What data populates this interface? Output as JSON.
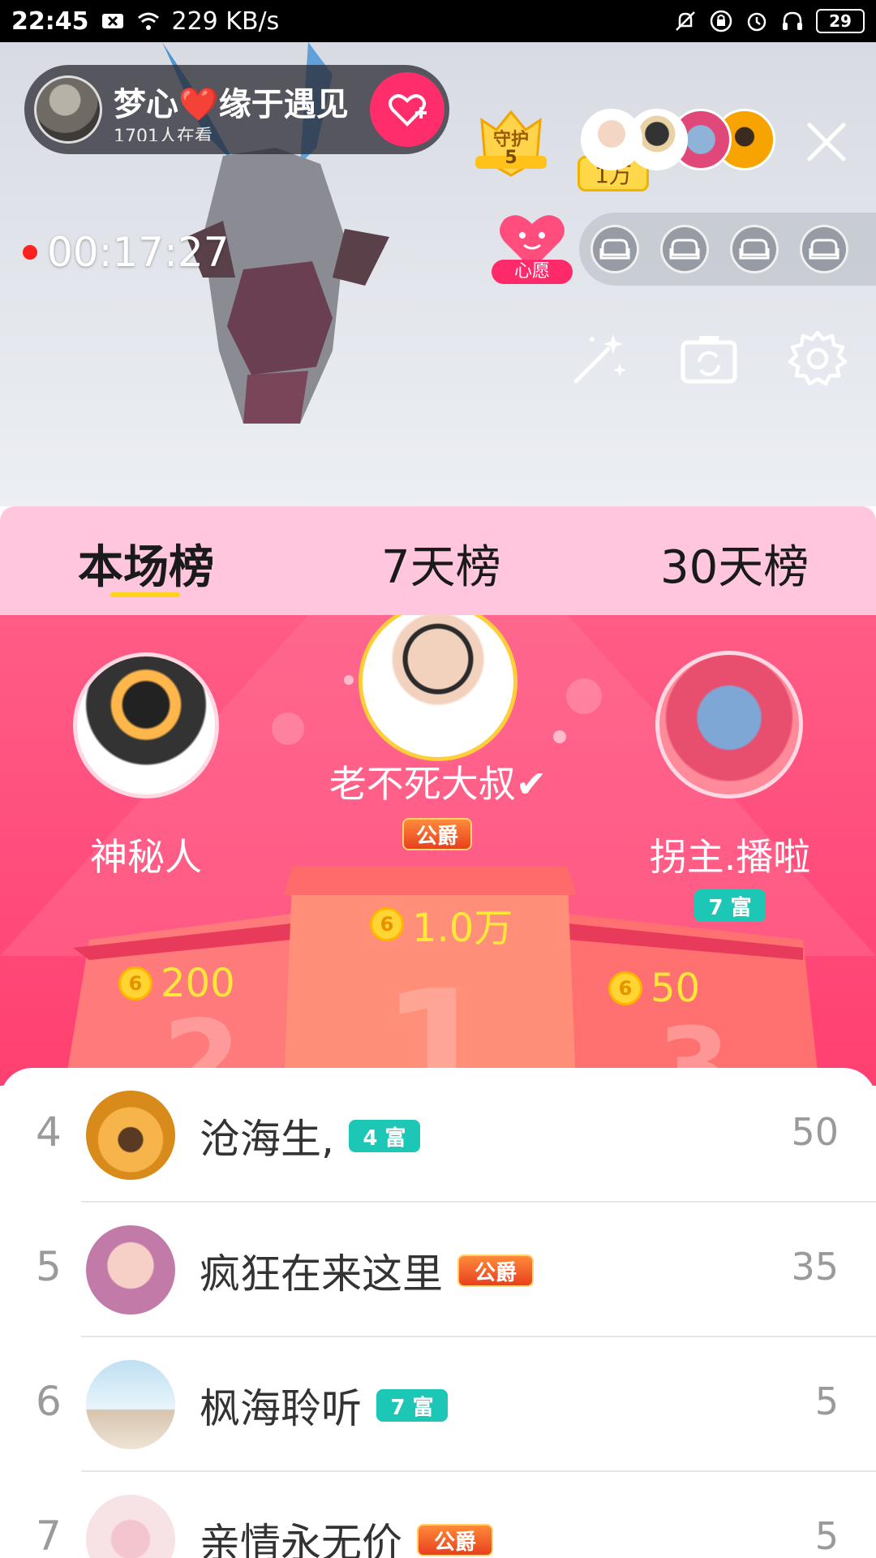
{
  "status_bar": {
    "time": "22:45",
    "net_speed": "229 KB/s",
    "battery": "29"
  },
  "live": {
    "host_name": "梦心❤️缘于遇见",
    "viewers_text": "1701人在看",
    "guard_label": "守护",
    "guard_count": "5",
    "audience_count": "1万",
    "timer": "00:17:27",
    "wish_label": "心愿"
  },
  "tabs": [
    {
      "label": "本场榜",
      "active": true
    },
    {
      "label": "7天榜",
      "active": false
    },
    {
      "label": "30天榜",
      "active": false
    }
  ],
  "podium": {
    "first": {
      "name": "老不死大叔✔",
      "badge": "公爵",
      "score": "1.0万",
      "place": "1"
    },
    "second": {
      "name": "神秘人",
      "score": "200",
      "place": "2"
    },
    "third": {
      "name": "拐主.播啦",
      "badge": "7 富",
      "score": "50",
      "place": "3"
    }
  },
  "list": [
    {
      "rank": "4",
      "name": "沧海生,",
      "badge": "4 富",
      "badge_type": "rich",
      "value": "50"
    },
    {
      "rank": "5",
      "name": "疯狂在来这里",
      "badge": "公爵",
      "badge_type": "duke",
      "value": "35"
    },
    {
      "rank": "6",
      "name": "枫海聆听",
      "badge": "7 富",
      "badge_type": "rich",
      "value": "5"
    },
    {
      "rank": "7",
      "name": "亲情永无价",
      "badge": "公爵",
      "badge_type": "duke",
      "value": "5"
    }
  ],
  "coin_glyph": "6",
  "colors": {
    "tab_bg": "#ffc6dd",
    "podium_bg": "#ff4e7d",
    "score_yellow": "#ffe83a",
    "rich_badge": "#1cc7b5",
    "duke_badge": "#e8401e"
  }
}
